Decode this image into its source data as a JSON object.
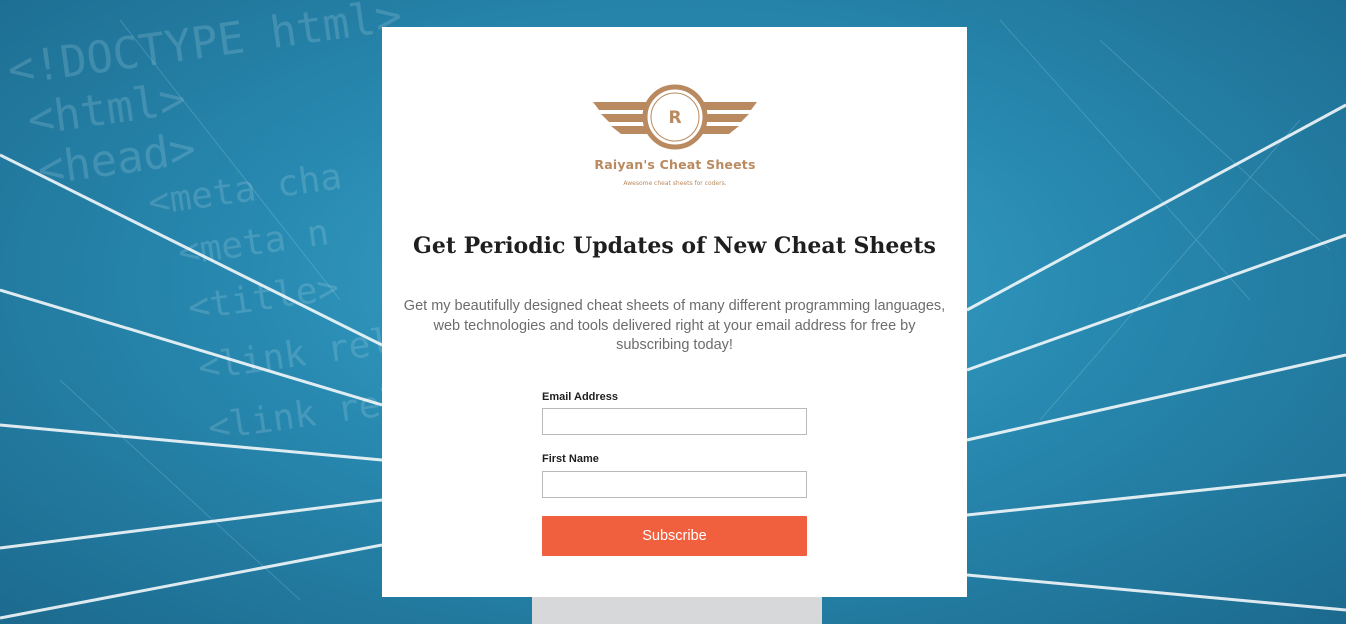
{
  "logo": {
    "letter": "R",
    "title": "Raiyan's Cheat Sheets",
    "tagline": "Awesome cheat sheets for coders.",
    "color": "#b98a60"
  },
  "heading": "Get Periodic Updates of New Cheat Sheets",
  "description": "Get my beautifully designed cheat sheets of many different programming languages, web technologies and tools delivered right at your email address for free by subscribing today!",
  "form": {
    "email_label": "Email Address",
    "email_value": "",
    "first_name_label": "First Name",
    "first_name_value": "",
    "subscribe_label": "Subscribe",
    "button_color": "#f0603f"
  },
  "background": {
    "code_lines": [
      "<!DOCTYPE html>",
      "<html>",
      "<head>",
      "<meta cha",
      "<meta n",
      "<title>",
      "<link rel",
      "<link rel"
    ]
  }
}
